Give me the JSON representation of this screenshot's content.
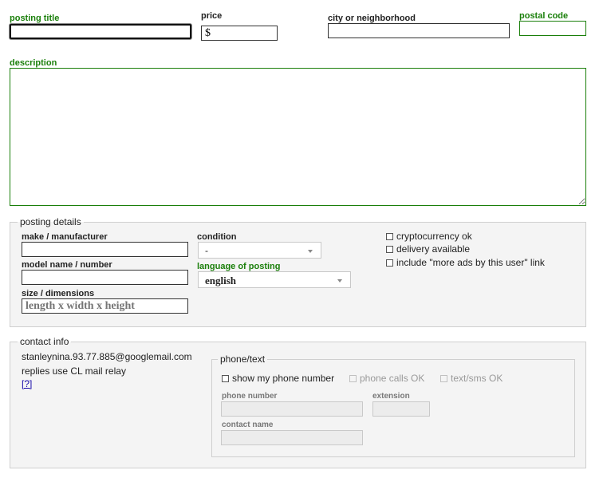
{
  "top": {
    "posting_title_label": "posting title",
    "price_label": "price",
    "price_value": "$",
    "city_label": "city or neighborhood",
    "postal_label": "postal code",
    "description_label": "description"
  },
  "posting_details": {
    "legend": "posting details",
    "make_label": "make / manufacturer",
    "model_label": "model name / number",
    "size_label": "size / dimensions",
    "size_placeholder": "length x width x height",
    "condition_label": "condition",
    "condition_value": "-",
    "language_label": "language of posting",
    "language_value": "english",
    "crypto_label": "cryptocurrency ok",
    "delivery_label": "delivery available",
    "more_ads_label": "include \"more ads by this user\" link"
  },
  "contact_info": {
    "legend": "contact info",
    "email": "stanleynina.93.77.885@googlemail.com",
    "relay_text": "replies use CL mail relay",
    "help_link": "[?]",
    "phone_legend": "phone/text",
    "show_phone_label": "show my phone number",
    "phone_calls_label": "phone calls OK",
    "text_sms_label": "text/sms OK",
    "phone_number_label": "phone number",
    "extension_label": "extension",
    "contact_name_label": "contact name"
  },
  "colors": {
    "accent_green": "#1a7f0a",
    "panel_bg": "#f4f4f4",
    "link_blue": "#1a0dab"
  }
}
